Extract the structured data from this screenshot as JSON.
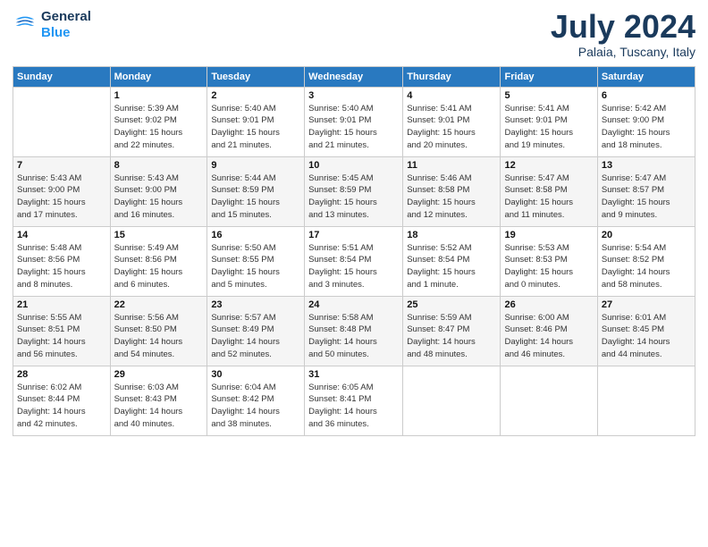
{
  "logo": {
    "line1": "General",
    "line2": "Blue"
  },
  "title": "July 2024",
  "subtitle": "Palaia, Tuscany, Italy",
  "days_of_week": [
    "Sunday",
    "Monday",
    "Tuesday",
    "Wednesday",
    "Thursday",
    "Friday",
    "Saturday"
  ],
  "weeks": [
    [
      {
        "day": "",
        "info": ""
      },
      {
        "day": "1",
        "info": "Sunrise: 5:39 AM\nSunset: 9:02 PM\nDaylight: 15 hours\nand 22 minutes."
      },
      {
        "day": "2",
        "info": "Sunrise: 5:40 AM\nSunset: 9:01 PM\nDaylight: 15 hours\nand 21 minutes."
      },
      {
        "day": "3",
        "info": "Sunrise: 5:40 AM\nSunset: 9:01 PM\nDaylight: 15 hours\nand 21 minutes."
      },
      {
        "day": "4",
        "info": "Sunrise: 5:41 AM\nSunset: 9:01 PM\nDaylight: 15 hours\nand 20 minutes."
      },
      {
        "day": "5",
        "info": "Sunrise: 5:41 AM\nSunset: 9:01 PM\nDaylight: 15 hours\nand 19 minutes."
      },
      {
        "day": "6",
        "info": "Sunrise: 5:42 AM\nSunset: 9:00 PM\nDaylight: 15 hours\nand 18 minutes."
      }
    ],
    [
      {
        "day": "7",
        "info": "Sunrise: 5:43 AM\nSunset: 9:00 PM\nDaylight: 15 hours\nand 17 minutes."
      },
      {
        "day": "8",
        "info": "Sunrise: 5:43 AM\nSunset: 9:00 PM\nDaylight: 15 hours\nand 16 minutes."
      },
      {
        "day": "9",
        "info": "Sunrise: 5:44 AM\nSunset: 8:59 PM\nDaylight: 15 hours\nand 15 minutes."
      },
      {
        "day": "10",
        "info": "Sunrise: 5:45 AM\nSunset: 8:59 PM\nDaylight: 15 hours\nand 13 minutes."
      },
      {
        "day": "11",
        "info": "Sunrise: 5:46 AM\nSunset: 8:58 PM\nDaylight: 15 hours\nand 12 minutes."
      },
      {
        "day": "12",
        "info": "Sunrise: 5:47 AM\nSunset: 8:58 PM\nDaylight: 15 hours\nand 11 minutes."
      },
      {
        "day": "13",
        "info": "Sunrise: 5:47 AM\nSunset: 8:57 PM\nDaylight: 15 hours\nand 9 minutes."
      }
    ],
    [
      {
        "day": "14",
        "info": "Sunrise: 5:48 AM\nSunset: 8:56 PM\nDaylight: 15 hours\nand 8 minutes."
      },
      {
        "day": "15",
        "info": "Sunrise: 5:49 AM\nSunset: 8:56 PM\nDaylight: 15 hours\nand 6 minutes."
      },
      {
        "day": "16",
        "info": "Sunrise: 5:50 AM\nSunset: 8:55 PM\nDaylight: 15 hours\nand 5 minutes."
      },
      {
        "day": "17",
        "info": "Sunrise: 5:51 AM\nSunset: 8:54 PM\nDaylight: 15 hours\nand 3 minutes."
      },
      {
        "day": "18",
        "info": "Sunrise: 5:52 AM\nSunset: 8:54 PM\nDaylight: 15 hours\nand 1 minute."
      },
      {
        "day": "19",
        "info": "Sunrise: 5:53 AM\nSunset: 8:53 PM\nDaylight: 15 hours\nand 0 minutes."
      },
      {
        "day": "20",
        "info": "Sunrise: 5:54 AM\nSunset: 8:52 PM\nDaylight: 14 hours\nand 58 minutes."
      }
    ],
    [
      {
        "day": "21",
        "info": "Sunrise: 5:55 AM\nSunset: 8:51 PM\nDaylight: 14 hours\nand 56 minutes."
      },
      {
        "day": "22",
        "info": "Sunrise: 5:56 AM\nSunset: 8:50 PM\nDaylight: 14 hours\nand 54 minutes."
      },
      {
        "day": "23",
        "info": "Sunrise: 5:57 AM\nSunset: 8:49 PM\nDaylight: 14 hours\nand 52 minutes."
      },
      {
        "day": "24",
        "info": "Sunrise: 5:58 AM\nSunset: 8:48 PM\nDaylight: 14 hours\nand 50 minutes."
      },
      {
        "day": "25",
        "info": "Sunrise: 5:59 AM\nSunset: 8:47 PM\nDaylight: 14 hours\nand 48 minutes."
      },
      {
        "day": "26",
        "info": "Sunrise: 6:00 AM\nSunset: 8:46 PM\nDaylight: 14 hours\nand 46 minutes."
      },
      {
        "day": "27",
        "info": "Sunrise: 6:01 AM\nSunset: 8:45 PM\nDaylight: 14 hours\nand 44 minutes."
      }
    ],
    [
      {
        "day": "28",
        "info": "Sunrise: 6:02 AM\nSunset: 8:44 PM\nDaylight: 14 hours\nand 42 minutes."
      },
      {
        "day": "29",
        "info": "Sunrise: 6:03 AM\nSunset: 8:43 PM\nDaylight: 14 hours\nand 40 minutes."
      },
      {
        "day": "30",
        "info": "Sunrise: 6:04 AM\nSunset: 8:42 PM\nDaylight: 14 hours\nand 38 minutes."
      },
      {
        "day": "31",
        "info": "Sunrise: 6:05 AM\nSunset: 8:41 PM\nDaylight: 14 hours\nand 36 minutes."
      },
      {
        "day": "",
        "info": ""
      },
      {
        "day": "",
        "info": ""
      },
      {
        "day": "",
        "info": ""
      }
    ]
  ]
}
